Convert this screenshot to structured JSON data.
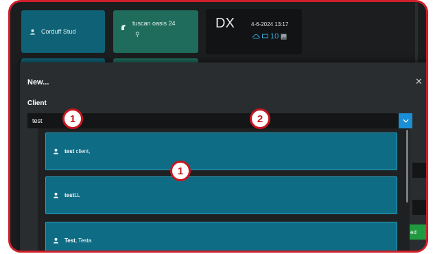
{
  "background": {
    "tiles": [
      {
        "name": "Corduff Stud"
      },
      {
        "name": "tuscan oasis 24"
      }
    ],
    "dx_tile": {
      "label": "DX",
      "date": "4-6-2024 13:17",
      "count": "10"
    },
    "green_button_label": "ed"
  },
  "modal": {
    "title": "New...",
    "close_glyph": "✕",
    "client_label": "Client",
    "client_value": "test"
  },
  "results": [
    {
      "match": "test",
      "rest": " client,"
    },
    {
      "match": "test",
      "rest": "LL"
    },
    {
      "match": "Test",
      "rest": ", Testa"
    }
  ],
  "annotations": {
    "badge_input": "1",
    "badge_dropdown": "2",
    "badge_results": "1"
  },
  "colors": {
    "accent": "#1a8fd6",
    "result_bg": "#0f6c85",
    "annotation_red": "#c9161f"
  }
}
